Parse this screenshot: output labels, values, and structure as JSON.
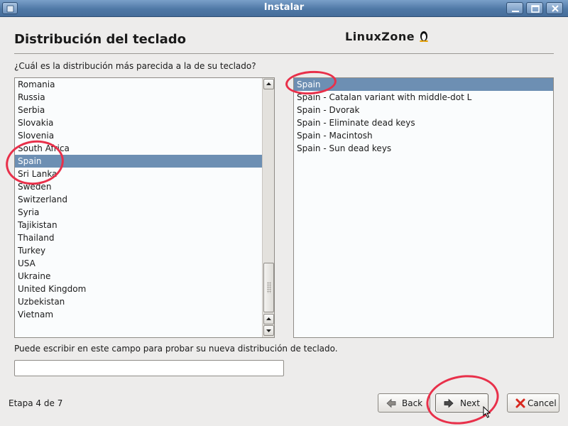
{
  "window": {
    "title": "Instalar"
  },
  "header": {
    "title": "Distribución del teclado",
    "logo_text": "LinuxZone"
  },
  "question": "¿Cuál es la distribución más parecida a la de su teclado?",
  "countries": {
    "items": [
      "Romania",
      "Russia",
      "Serbia",
      "Slovakia",
      "Slovenia",
      "South Africa",
      "Spain",
      "Sri Lanka",
      "Sweden",
      "Switzerland",
      "Syria",
      "Tajikistan",
      "Thailand",
      "Turkey",
      "USA",
      "Ukraine",
      "United Kingdom",
      "Uzbekistan",
      "Vietnam"
    ],
    "selected": "Spain"
  },
  "variants": {
    "items": [
      "Spain",
      "Spain - Catalan variant with middle-dot L",
      "Spain - Dvorak",
      "Spain - Eliminate dead keys",
      "Spain - Macintosh",
      "Spain - Sun dead keys"
    ],
    "selected": "Spain"
  },
  "test_field": {
    "label": "Puede escribir en este campo para probar su nueva distribución de teclado.",
    "value": ""
  },
  "footer": {
    "step": "Etapa 4 de 7",
    "back_label": "Back",
    "next_label": "Next",
    "cancel_label": "Cancel"
  },
  "colors": {
    "selection": "#6d8fb3",
    "titlebar": "#4f78a6",
    "annotation": "#e8304a"
  },
  "icons": {
    "back": "arrow-left-icon",
    "next": "arrow-right-icon",
    "cancel": "cross-icon"
  }
}
